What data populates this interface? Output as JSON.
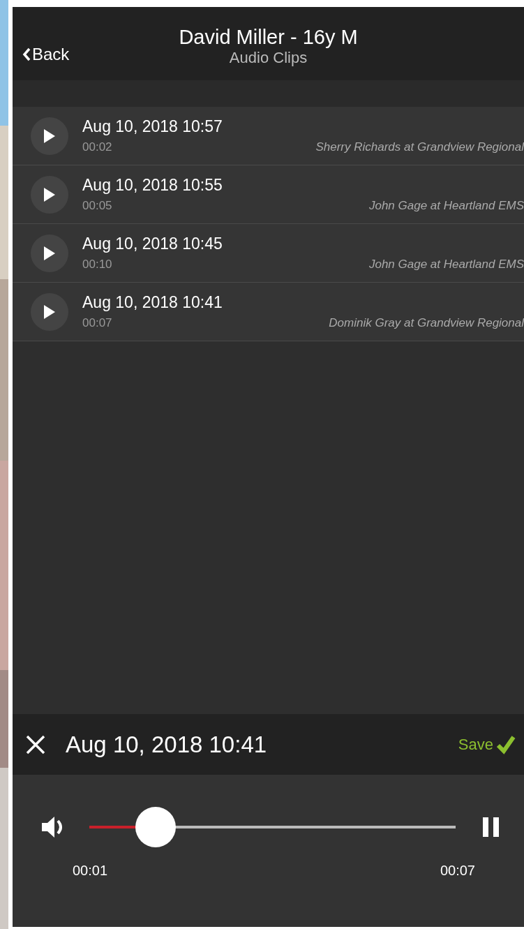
{
  "header": {
    "back": "Back",
    "title": "David Miller - 16y M",
    "subtitle": "Audio Clips"
  },
  "clips": [
    {
      "date": "Aug 10, 2018 10:57",
      "duration": "00:02",
      "source": "Sherry Richards at Grandview Regional"
    },
    {
      "date": "Aug 10, 2018 10:55",
      "duration": "00:05",
      "source": "John Gage at Heartland EMS"
    },
    {
      "date": "Aug 10, 2018 10:45",
      "duration": "00:10",
      "source": "John Gage at Heartland EMS"
    },
    {
      "date": "Aug 10, 2018 10:41",
      "duration": "00:07",
      "source": "Dominik Gray at Grandview Regional"
    }
  ],
  "player": {
    "title": "Aug 10, 2018 10:41",
    "save": "Save",
    "level": 0.18,
    "elapsed": "00:01",
    "total": "00:07",
    "playing": true
  }
}
